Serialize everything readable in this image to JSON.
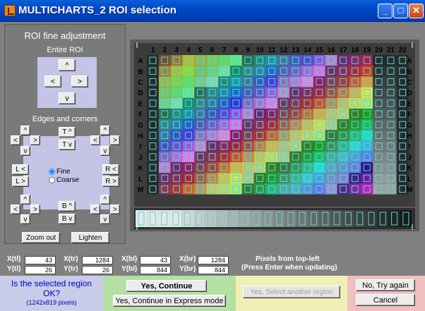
{
  "window": {
    "title": "MULTICHARTS_2 ROI selection",
    "minimize": "_",
    "maximize": "□",
    "close": "✕"
  },
  "roi": {
    "heading": "ROI fine adjustment",
    "entire_label": "Entire ROI",
    "up": "^",
    "down": "v",
    "left": "<",
    "right": ">",
    "edges_label": "Edges and corners",
    "caret": "^",
    "vee": "v",
    "lt": "<",
    "gt": ">",
    "top_up": "T ^",
    "top_down": "T v",
    "left_left": "L <",
    "left_right": "L >",
    "right_left": "R <",
    "right_right": "R >",
    "bottom_up": "B ^",
    "bottom_down": "B v",
    "fine": "Fine",
    "coarse": "Coarse",
    "zoom_out": "Zoom out",
    "lighten": "Lighten"
  },
  "chart": {
    "cols": [
      "1",
      "2",
      "3",
      "4",
      "5",
      "6",
      "7",
      "8",
      "9",
      "10",
      "11",
      "12",
      "13",
      "14",
      "15",
      "16",
      "17",
      "18",
      "19",
      "20",
      "21",
      "22"
    ],
    "rows": [
      "A",
      "B",
      "C",
      "D",
      "E",
      "F",
      "G",
      "H",
      "I",
      "J",
      "K",
      "L",
      "M"
    ]
  },
  "coords": {
    "xtl_label": "X(tl)",
    "xtl": "43",
    "ytl_label": "Y(tl)",
    "ytl": "26",
    "xtr_label": "X(tr)",
    "xtr": "1284",
    "ytr_label": "Y(tr)",
    "ytr": "26",
    "xbl_label": "X(bl)",
    "xbl": "43",
    "ybl_label": "Y(bl)",
    "ybl": "844",
    "xbr_label": "X(br)",
    "xbr": "1284",
    "ybr_label": "Y(br)",
    "ybr": "844",
    "note1": "Pixels from top-left",
    "note2": "(Press Enter when updating)"
  },
  "footer": {
    "question": "Is the selected region OK?",
    "size": "(1242x819 pixels)",
    "yes_continue": "Yes, Continue",
    "yes_express": "Yes, Continue in Express mode",
    "yes_select": "Yes, Select another region",
    "no_try": "No, Try again",
    "cancel": "Cancel"
  },
  "colors": {
    "accent_blue": "#0a5fd8",
    "roi_box": "#40e0e0",
    "footer_blue": "#c8cce8",
    "footer_green": "#b4e0a4",
    "footer_yellow": "#f0f0b4",
    "footer_pink": "#f0c0c0"
  }
}
